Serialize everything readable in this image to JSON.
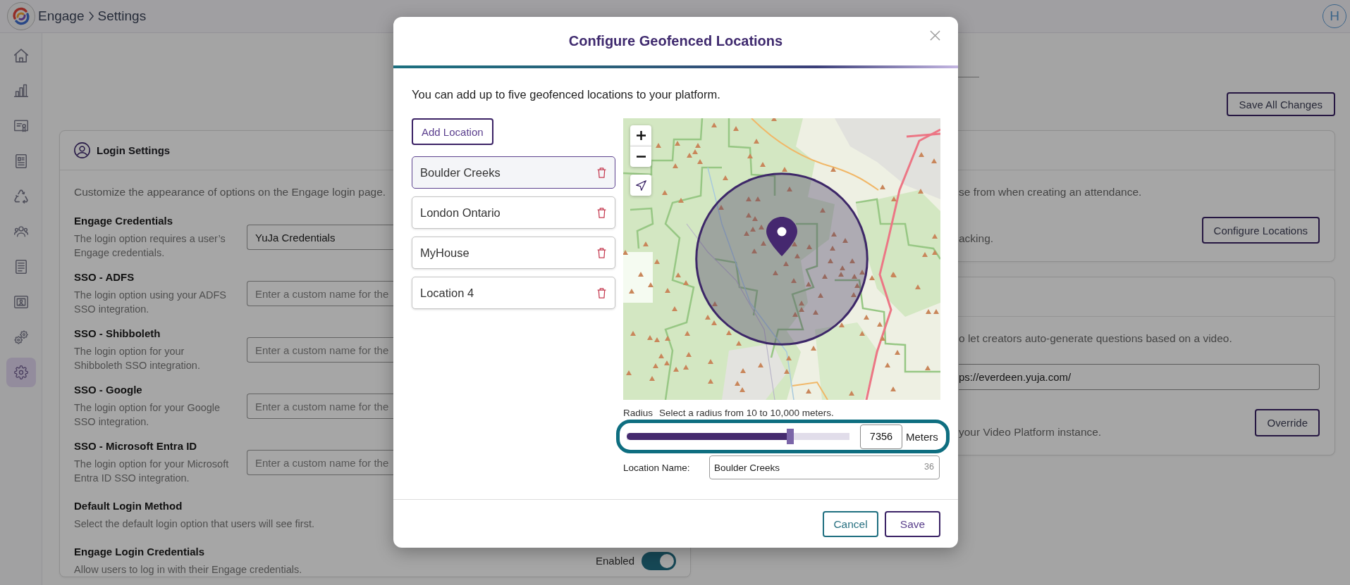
{
  "header": {
    "breadcrumb": [
      "Engage",
      "Settings"
    ],
    "avatar": "H"
  },
  "sidebar": {
    "items": [
      {
        "kind": "home",
        "selected": false
      },
      {
        "kind": "chart",
        "selected": false
      },
      {
        "kind": "certificate",
        "selected": false
      },
      {
        "kind": "report",
        "selected": false
      },
      {
        "kind": "recycle",
        "selected": false
      },
      {
        "kind": "people",
        "selected": false
      },
      {
        "kind": "list",
        "selected": false
      },
      {
        "kind": "frame",
        "selected": false
      },
      {
        "kind": "gears",
        "selected": false
      },
      {
        "kind": "settings",
        "selected": true
      }
    ]
  },
  "toolbar": {
    "save_button": "Save All Changes"
  },
  "login_settings": {
    "title": "Login Settings",
    "intro": "Customize the appearance of options on the Engage login page.",
    "fields": [
      {
        "title": "Engage Credentials",
        "description": "The login option requires a user’s Engage credentials.",
        "value": "YuJa Credentials"
      },
      {
        "title": "SSO - ADFS",
        "description": "The login option using your ADFS SSO integration.",
        "placeholder": "Enter a custom name for the"
      },
      {
        "title": "SSO - Shibboleth",
        "description": "The login option for your Shibboleth SSO integration.",
        "placeholder": "Enter a custom name for the"
      },
      {
        "title": "SSO - Google",
        "description": "The login option for your Google SSO integration.",
        "placeholder": "Enter a custom name for the"
      },
      {
        "title": "SSO - Microsoft Entra ID",
        "description": "The login option for your Microsoft Entra ID SSO integration.",
        "placeholder": "Enter a custom name for the"
      }
    ],
    "default_method": {
      "title": "Default Login Method",
      "description": "Select the default login option that users will see first."
    },
    "login_credentials": {
      "title": "Engage Login Credentials",
      "description": "Allow users to log in with their Engage credentials.",
      "toggle_label": "Enabled",
      "on": true
    }
  },
  "attendance_card": {
    "description": "se from when creating an attendance.",
    "note": "acking.",
    "button": "Configure Locations"
  },
  "question_card": {
    "description": "o let creators auto-generate questions based on a video.",
    "url": {
      "value": "ps://everdeen.yuja.com/"
    },
    "note": "your Video Platform instance.",
    "button": "Override"
  },
  "modal": {
    "title": "Configure Geofenced Locations",
    "intro": "You can add up to five geofenced locations to your platform.",
    "add_button": "Add Location",
    "locations": [
      {
        "name": "Boulder Creeks",
        "selected": true
      },
      {
        "name": "London Ontario",
        "selected": false
      },
      {
        "name": "MyHouse",
        "selected": false
      },
      {
        "name": "Location 4",
        "selected": false
      }
    ],
    "radius": {
      "label": "Radius",
      "hint": "Select a radius from 10 to 10,000 meters.",
      "focused": true,
      "level": 0.735,
      "value": "7356",
      "unit": "Meters"
    },
    "location_name": {
      "label": "Location Name:",
      "value": "Boulder Creeks",
      "counter": "36"
    },
    "cancel_button": "Cancel",
    "save_button": "Save"
  }
}
